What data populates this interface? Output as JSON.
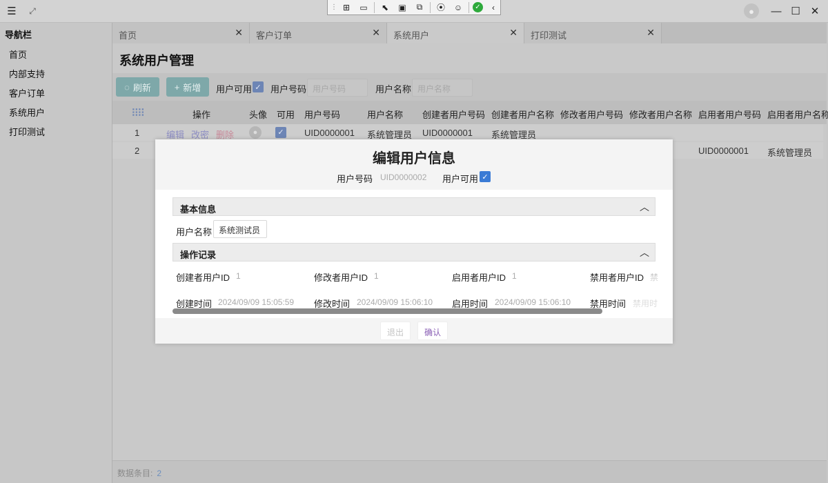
{
  "titlebar": {
    "menu_icon": "hamburger-icon",
    "expand_icon": "expand-icon",
    "devtools": [
      "select-element-icon",
      "video-icon",
      "inspect-pointer-icon",
      "layout-box-icon",
      "screenshot-icon",
      "broadcast-icon",
      "accessibility-icon",
      "check-circle-icon",
      "chevron-left-icon"
    ]
  },
  "sidebar": {
    "title": "导航栏",
    "items": [
      "首页",
      "内部支持",
      "客户订单",
      "系统用户",
      "打印测试"
    ]
  },
  "tabs": [
    {
      "label": "首页"
    },
    {
      "label": "客户订单"
    },
    {
      "label": "系统用户"
    },
    {
      "label": "打印测试"
    }
  ],
  "page": {
    "title": "系统用户管理",
    "toolbar": {
      "refresh_label": "刷新",
      "add_label": "新增",
      "user_enabled_label": "用户可用",
      "user_code_label": "用户号码",
      "user_code_placeholder": "用户号码",
      "user_name_label": "用户名称",
      "user_name_placeholder": "用户名称"
    },
    "columns": [
      "操作",
      "头像",
      "可用",
      "用户号码",
      "用户名称",
      "创建者用户号码",
      "创建者用户名称",
      "修改者用户号码",
      "修改者用户名称",
      "启用者用户号码",
      "启用者用户名称"
    ],
    "rows": [
      {
        "index": "1",
        "actions": [
          "编辑",
          "改密",
          "删除"
        ],
        "user_code": "UID0000001",
        "user_name": "系统管理员",
        "creator_code": "UID0000001",
        "creator_name": "系统管理员",
        "enabler_code": "",
        "enabler_name": ""
      },
      {
        "index": "2",
        "enabler_code": "UID0000001",
        "enabler_name": "系统管理员"
      }
    ],
    "footer_label": "数据条目:",
    "footer_count": "2"
  },
  "modal": {
    "title": "编辑用户信息",
    "user_code_label": "用户号码",
    "user_code_value": "UID0000002",
    "user_enabled_label": "用户可用",
    "section_basic": "基本信息",
    "user_name_label": "用户名称",
    "user_name_value": "系统测试员",
    "section_log": "操作记录",
    "fields": {
      "creator_id_label": "创建者用户ID",
      "creator_id_value": "1",
      "modifier_id_label": "修改者用户ID",
      "modifier_id_value": "1",
      "enabler_id_label": "启用者用户ID",
      "enabler_id_value": "1",
      "disabler_id_label": "禁用者用户ID",
      "disabler_id_value": "禁",
      "create_time_label": "创建时间",
      "create_time_value": "2024/09/09 15:05:59",
      "modify_time_label": "修改时间",
      "modify_time_value": "2024/09/09 15:06:10",
      "enable_time_label": "启用时间",
      "enable_time_value": "2024/09/09 15:06:10",
      "disable_time_label": "禁用时间",
      "disable_time_value": "禁用时"
    },
    "cancel_label": "退出",
    "confirm_label": "确认"
  }
}
